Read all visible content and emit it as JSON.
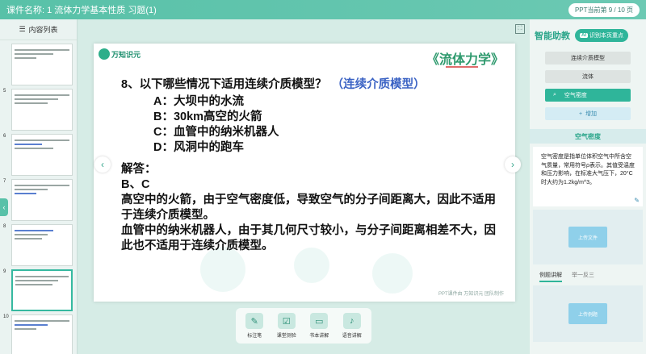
{
  "topbar": {
    "title": "课件名称: 1 流体力学基本性质 习题(1)",
    "page_indicator": "PPT当前第 9 / 10 页"
  },
  "sidebar": {
    "header": "内容列表",
    "thumbs": [
      {
        "num": "",
        "active": false
      },
      {
        "num": "5",
        "active": false
      },
      {
        "num": "6",
        "active": false
      },
      {
        "num": "7",
        "active": false
      },
      {
        "num": "8",
        "active": false
      },
      {
        "num": "9",
        "active": true
      },
      {
        "num": "10",
        "active": false
      }
    ]
  },
  "slide": {
    "logo": "万知识元",
    "course_title": "《流体力学》",
    "question": "8、以下哪些情况下适用连续介质模型？",
    "question_hint": "（连续介质模型）",
    "options": [
      "A：大坝中的水流",
      "B：30km高空的火箭",
      "C：血管中的纳米机器人",
      "D：风洞中的跑车"
    ],
    "answer_label": "解答：",
    "answer": "B、C",
    "explanation_1": "高空中的火箭，由于空气密度低，导致空气的分子间距离大，因此不适用于连续介质模型。",
    "explanation_2": "血管中的纳米机器人，由于其几何尺寸较小，与分子间距离相差不大，因此也不适用于连续介质模型。",
    "footer": "PPT课件由 万知识元 团队制作"
  },
  "toolbar": {
    "items": [
      {
        "label": "标注笔",
        "icon": "pen-icon"
      },
      {
        "label": "课堂测验",
        "icon": "quiz-icon"
      },
      {
        "label": "书本讲解",
        "icon": "book-icon"
      },
      {
        "label": "语音讲解",
        "icon": "voice-icon"
      }
    ]
  },
  "rpanel": {
    "brand": "智能助教",
    "ai_badge": "AI",
    "ai_button": "识别本页重点",
    "knowledge_points": [
      "连续介质模型",
      "流体",
      "空气密度"
    ],
    "active_point": "空气密度",
    "add_label": "增加",
    "definition_title": "空气密度",
    "definition_text": "空气密度是指单位体积空气中所含空气质量，常用符号ρ表示。其值受温度和压力影响，在标准大气压下，20°C时大约为1.2kg/m^3。",
    "upload_file": "上传文件",
    "tab_example": "例题讲解",
    "tab_inference": "举一反三",
    "upload_example": "上传例题"
  },
  "colors": {
    "accent": "#2fb59a",
    "topbar": "#58c1a8",
    "question_hint": "#3b63c4"
  }
}
